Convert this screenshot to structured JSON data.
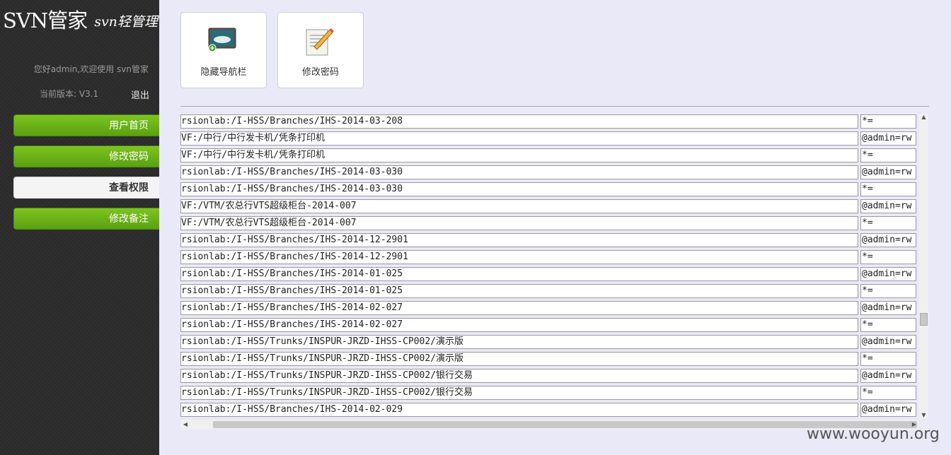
{
  "app": {
    "logo": "SVN管家",
    "tagline": "svn轻管理",
    "welcome": "您好admin,欢迎使用 svn管家",
    "version": "当前版本: V3.1",
    "logout": "退出"
  },
  "nav": [
    "用户首页",
    "修改密码",
    "查看权限",
    "修改备注"
  ],
  "active_nav": "查看权限",
  "toolbar": {
    "hide_nav": "隐藏导航栏",
    "change_password": "修改密码"
  },
  "table": {
    "rows": [
      [
        "rsionlab:/I-HSS/Branches/IHS-2014-03-208",
        "*="
      ],
      [
        "VF:/中行/中行发卡机/凭条打印机",
        "@admin=rw"
      ],
      [
        "VF:/中行/中行发卡机/凭条打印机",
        "*="
      ],
      [
        "rsionlab:/I-HSS/Branches/IHS-2014-03-030",
        "@admin=rw"
      ],
      [
        "rsionlab:/I-HSS/Branches/IHS-2014-03-030",
        "*="
      ],
      [
        "VF:/VTM/农总行VTS超级柜台-2014-007",
        "@admin=rw"
      ],
      [
        "VF:/VTM/农总行VTS超级柜台-2014-007",
        "*="
      ],
      [
        "rsionlab:/I-HSS/Branches/IHS-2014-12-2901",
        "@admin=rw"
      ],
      [
        "rsionlab:/I-HSS/Branches/IHS-2014-12-2901",
        "*="
      ],
      [
        "rsionlab:/I-HSS/Branches/IHS-2014-01-025",
        "@admin=rw"
      ],
      [
        "rsionlab:/I-HSS/Branches/IHS-2014-01-025",
        "*="
      ],
      [
        "rsionlab:/I-HSS/Branches/IHS-2014-02-027",
        "@admin=rw"
      ],
      [
        "rsionlab:/I-HSS/Branches/IHS-2014-02-027",
        "*="
      ],
      [
        "rsionlab:/I-HSS/Trunks/INSPUR-JRZD-IHSS-CP002/演示版",
        "@admin=rw"
      ],
      [
        "rsionlab:/I-HSS/Trunks/INSPUR-JRZD-IHSS-CP002/演示版",
        "*="
      ],
      [
        "rsionlab:/I-HSS/Trunks/INSPUR-JRZD-IHSS-CP002/银行交易",
        "@admin=rw"
      ],
      [
        "rsionlab:/I-HSS/Trunks/INSPUR-JRZD-IHSS-CP002/银行交易",
        "*="
      ],
      [
        "rsionlab:/I-HSS/Branches/IHS-2014-02-029",
        "@admin=rw"
      ]
    ]
  },
  "watermark": "www.wooyun.org"
}
